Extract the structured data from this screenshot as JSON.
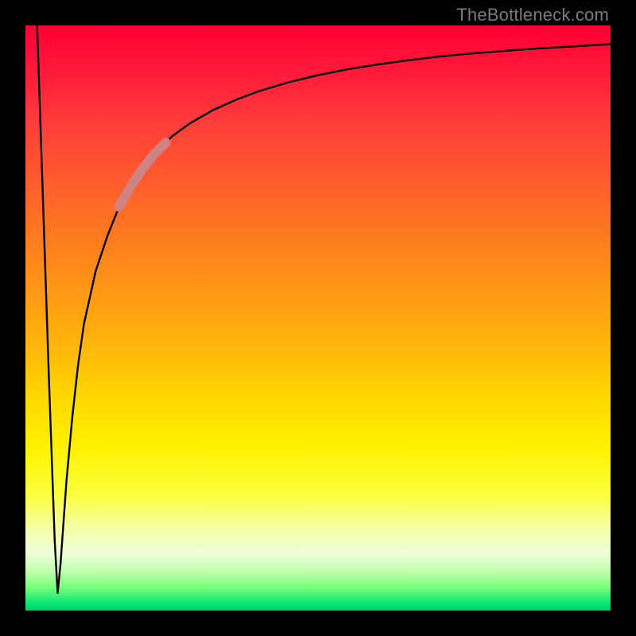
{
  "watermark": "TheBottleneck.com",
  "colors": {
    "frame": "#000000",
    "watermark": "#7a7a7a",
    "curve": "#000000",
    "segment": "#cf8282"
  },
  "chart_data": {
    "type": "line",
    "title": "",
    "xlabel": "",
    "ylabel": "",
    "xlim": [
      0,
      100
    ],
    "ylim": [
      0,
      100
    ],
    "grid": false,
    "series": [
      {
        "name": "bottleneck-curve",
        "x": [
          2,
          3,
          4,
          5,
          5.5,
          6,
          7,
          8,
          9,
          10,
          12,
          14,
          16,
          18,
          20,
          22,
          25,
          28,
          32,
          36,
          40,
          45,
          50,
          55,
          60,
          65,
          70,
          75,
          80,
          85,
          90,
          95,
          100
        ],
        "y": [
          100,
          70,
          40,
          12,
          3,
          8,
          22,
          33,
          42,
          49,
          58,
          64,
          69,
          72.5,
          75.5,
          78,
          81,
          83.2,
          85.5,
          87.3,
          88.8,
          90.3,
          91.5,
          92.5,
          93.3,
          94,
          94.6,
          95.1,
          95.5,
          95.9,
          96.2,
          96.5,
          96.8
        ]
      },
      {
        "name": "highlighted-segment",
        "x": [
          16,
          18,
          20,
          22,
          24
        ],
        "y": [
          69,
          72.5,
          75.5,
          78,
          80
        ]
      }
    ],
    "annotations": [
      {
        "text": "TheBottleneck.com",
        "position": "top-right"
      }
    ]
  }
}
